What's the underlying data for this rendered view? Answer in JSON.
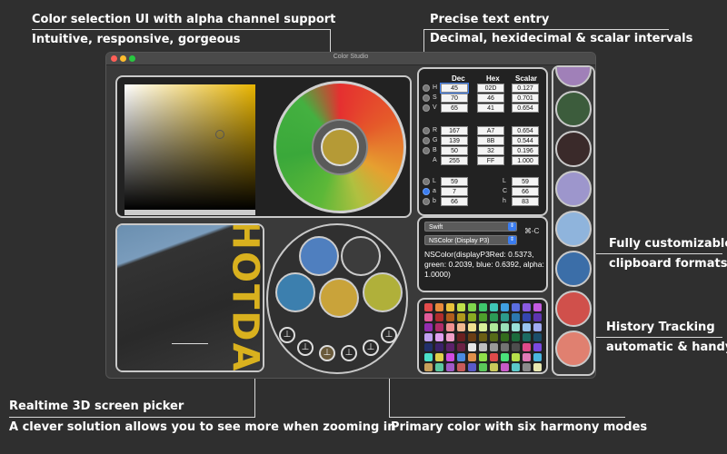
{
  "callouts": {
    "color_selection_title": "Color selection UI with alpha channel support",
    "color_selection_sub": "Intuitive, responsive, gorgeous",
    "precise_title": "Precise text entry",
    "precise_sub": "Decimal, hexidecimal & scalar intervals",
    "clipboard_title": "Fully customizable",
    "clipboard_sub": "clipboard formats",
    "history_title": "History Tracking",
    "history_sub": "automatic & handy",
    "picker_title": "Realtime 3D screen picker",
    "picker_sub": "A clever solution allows you to see more when zooming in",
    "harmony_title": "Primary color with six harmony modes"
  },
  "window": {
    "title": "Color Studio"
  },
  "table": {
    "headers": {
      "dec": "Dec",
      "hex": "Hex",
      "scalar": "Scalar"
    },
    "hsv": [
      {
        "label": "H",
        "dec": "45",
        "hex": "02D",
        "scalar": "0.127"
      },
      {
        "label": "S",
        "dec": "70",
        "hex": "46",
        "scalar": "0.701"
      },
      {
        "label": "V",
        "dec": "65",
        "hex": "41",
        "scalar": "0.654"
      }
    ],
    "rgba": [
      {
        "label": "R",
        "dec": "167",
        "hex": "A7",
        "scalar": "0.654"
      },
      {
        "label": "G",
        "dec": "139",
        "hex": "8B",
        "scalar": "0.544"
      },
      {
        "label": "B",
        "dec": "50",
        "hex": "32",
        "scalar": "0.196"
      },
      {
        "label": "A",
        "dec": "255",
        "hex": "FF",
        "scalar": "1.000"
      }
    ],
    "lab": [
      {
        "label": "L",
        "dec": "59",
        "rlabel": "L",
        "rval": "59"
      },
      {
        "label": "a",
        "dec": "7",
        "rlabel": "C",
        "rval": "66"
      },
      {
        "label": "b",
        "dec": "66",
        "rlabel": "h",
        "rval": "83"
      }
    ]
  },
  "clipboard": {
    "language": "Swift",
    "format": "NSColor (Display P3)",
    "shortcut": "⌘-C",
    "output": "NSColor(displayP3Red: 0.5373, green: 0.2039, blue: 0.6392, alpha: 1.0000)"
  },
  "picker_text": "HOTDA",
  "colors": {
    "accent": "#3b7df0",
    "primary": "#a78b32"
  },
  "icons": {
    "harmony": "harmony-mode-icon",
    "radio": "radio-icon"
  },
  "palette": [
    "#e34b4b",
    "#e88a3b",
    "#e8c23b",
    "#bfe04a",
    "#7fd54c",
    "#3fc76d",
    "#3fc7b6",
    "#3f9fe0",
    "#5b6ee0",
    "#8a5be0",
    "#c45be0",
    "#e05b9a",
    "#b02d2d",
    "#b05e1c",
    "#b09a1c",
    "#8aac22",
    "#4ea02c",
    "#2c9b57",
    "#2c9b8c",
    "#2c78b0",
    "#3546b0",
    "#5e35b0",
    "#932db0",
    "#b02d6a",
    "#f09090",
    "#f0b890",
    "#f0e090",
    "#d8f09a",
    "#b0e89a",
    "#9ae0b8",
    "#9ae0d8",
    "#9ac4f0",
    "#a0aaf0",
    "#c0a0f0",
    "#e0a0f0",
    "#f0a0c8",
    "#6b2020",
    "#6b3e14",
    "#6b5f14",
    "#566b18",
    "#336b1c",
    "#1c6b3c",
    "#1c6b63",
    "#1c4f6b",
    "#22306b",
    "#3b226b",
    "#5c226b",
    "#6b2244",
    "#e6e6e6",
    "#bfbfbf",
    "#999999",
    "#737373",
    "#4d4d4d",
    "#e04a8a",
    "#7a4ae0",
    "#4ae0c8",
    "#e0d04a",
    "#d04ae0",
    "#4a8ae0",
    "#e0904a",
    "#90e04a",
    "#e04a4a",
    "#4ae07a",
    "#b6e04a",
    "#e07ab6",
    "#4ab6e0",
    "#c8a05a",
    "#5ac8a0",
    "#a05ac8",
    "#c85a5a",
    "#5a5ac8",
    "#5ac85a",
    "#c8c85a",
    "#c85ac8",
    "#5ac8c8",
    "#8a8a8a",
    "#e8e8b0"
  ],
  "history": [
    "#d0504b",
    "#8fb4dc",
    "#3b6ea8",
    "#9d96cc",
    "#3a2a2a",
    "#3c5c3c",
    "#a080b8"
  ],
  "harmony_colors": [
    "#4f7fbf",
    "#c9a33a",
    "#b0b03a",
    "#3c7fae"
  ]
}
